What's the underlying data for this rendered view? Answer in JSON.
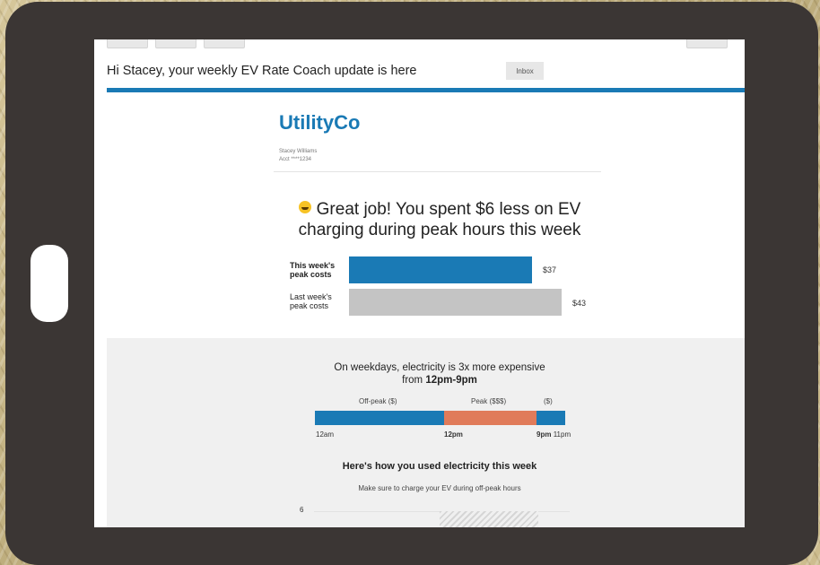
{
  "email": {
    "subject": "Hi Stacey, your weekly EV Rate Coach update is here",
    "inbox_label": "Inbox"
  },
  "brand": {
    "logo": "UtilityCo",
    "customer_name": "Stacey Williams",
    "account": "Acct ****1234",
    "color": "#1a7ab5"
  },
  "headline": {
    "line1": "Great job! You spent $6 less on EV",
    "line2": "charging during peak hours this week",
    "emoji_icon": "smiley-icon"
  },
  "comparison": {
    "rows": [
      {
        "label_line1": "This week's",
        "label_line2": "peak costs",
        "value_text": "$37",
        "value": 37,
        "color": "#1a7ab5"
      },
      {
        "label_line1": "Last week's",
        "label_line2": "peak costs",
        "value_text": "$43",
        "value": 43,
        "color": "#c4c4c4"
      }
    ]
  },
  "time_of_use": {
    "title_line1": "On weekdays, electricity is 3x more expensive",
    "title_prefix": "from ",
    "title_bold": "12pm-9pm",
    "labels": {
      "offpeak": "Off-peak ($)",
      "peak": "Peak ($$$)",
      "evening": "($)"
    },
    "ticks": {
      "start": "12am",
      "peak_start": "12pm",
      "peak_end": "9pm",
      "end": "11pm"
    },
    "offpeak_color": "#1a7ab5",
    "peak_color": "#e07b5a"
  },
  "usage": {
    "title": "Here's how you used electricity this week",
    "subtitle": "Make sure to charge your EV during off-peak hours",
    "y_tick_top": "6"
  }
}
